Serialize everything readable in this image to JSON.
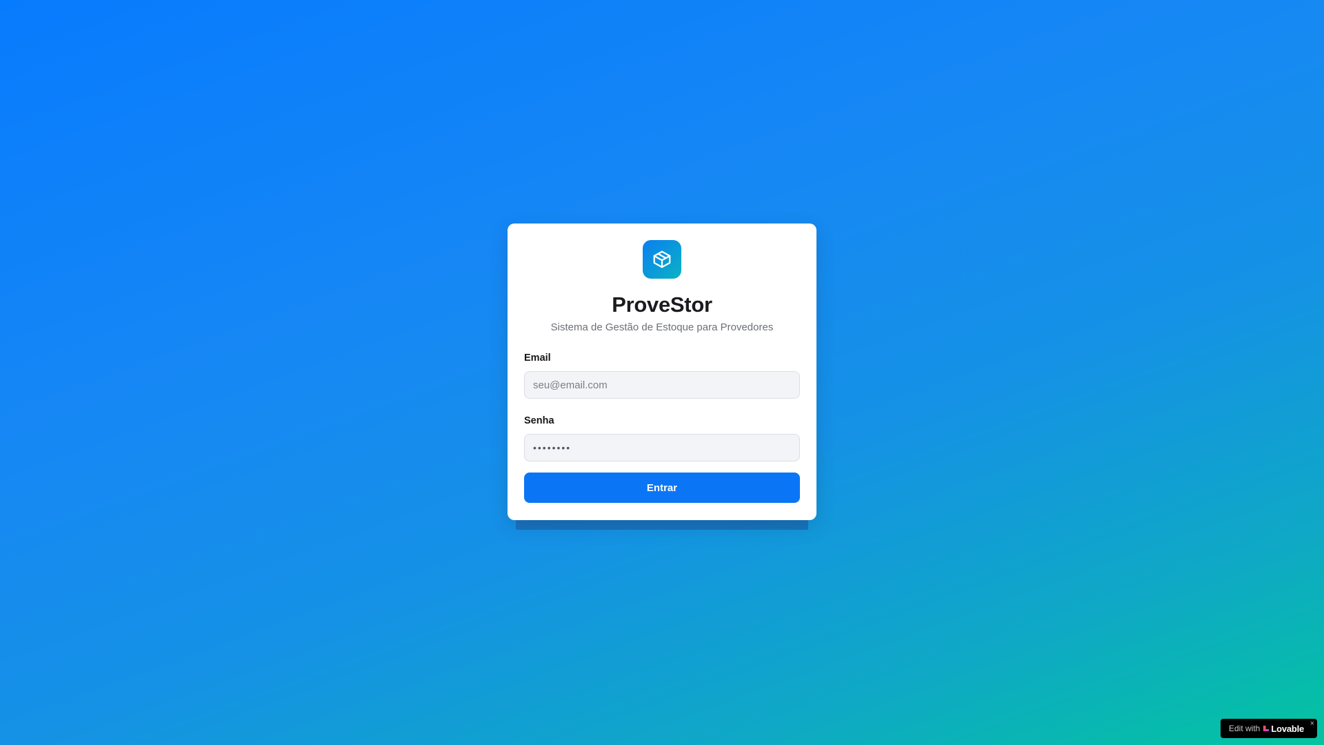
{
  "app": {
    "title": "ProveStor",
    "subtitle": "Sistema de Gestão de Estoque para Provedores",
    "logo_icon": "package-icon"
  },
  "form": {
    "email": {
      "label": "Email",
      "placeholder": "seu@email.com",
      "value": ""
    },
    "password": {
      "label": "Senha",
      "value": "••••••••"
    },
    "submit_label": "Entrar"
  },
  "badge": {
    "prefix": "Edit with",
    "brand": "Lovable",
    "close": "×"
  },
  "colors": {
    "primary": "#0a76f6",
    "gradient_start": "#077bfd",
    "gradient_end": "#03c4a0"
  }
}
